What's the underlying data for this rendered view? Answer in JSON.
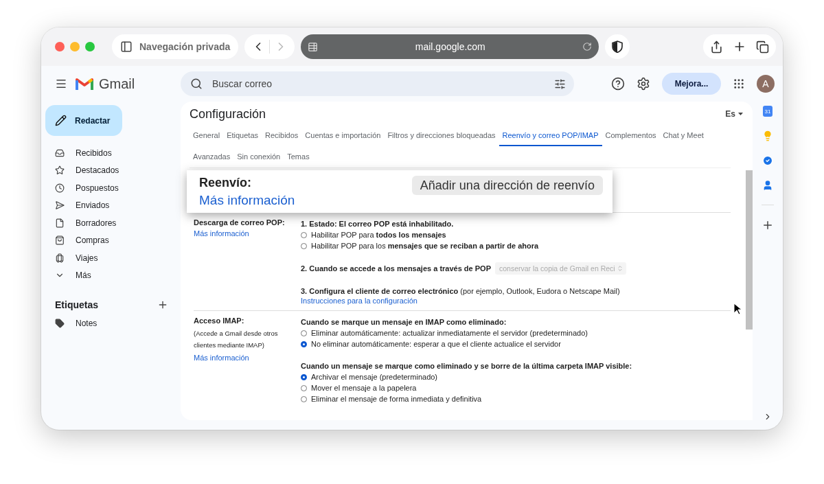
{
  "browser": {
    "private_label": "Navegación privada",
    "url": "mail.google.com"
  },
  "header": {
    "brand": "Gmail",
    "search_placeholder": "Buscar correo",
    "upgrade_button": "Mejora...",
    "avatar": "A"
  },
  "sidebar": {
    "compose": "Redactar",
    "items": [
      {
        "label": "Recibidos",
        "selected": false
      },
      {
        "label": "Destacados",
        "selected": false
      },
      {
        "label": "Pospuestos",
        "selected": false
      },
      {
        "label": "Enviados",
        "selected": false
      },
      {
        "label": "Borradores",
        "selected": false
      },
      {
        "label": "Compras",
        "selected": false
      },
      {
        "label": "Viajes",
        "selected": false
      },
      {
        "label": "Más",
        "selected": false
      }
    ],
    "labels_heading": "Etiquetas",
    "labels": [
      {
        "name": "Notes"
      }
    ]
  },
  "side_panel": {
    "calendar_day": "31"
  },
  "settings": {
    "title": "Configuración",
    "language": "Es",
    "tabs": [
      {
        "label": "General",
        "selected": false
      },
      {
        "label": "Etiquetas",
        "selected": false
      },
      {
        "label": "Recibidos",
        "selected": false
      },
      {
        "label": "Cuentas e importación",
        "selected": false
      },
      {
        "label": "Filtros y direcciones bloqueadas",
        "selected": false
      },
      {
        "label": "Reenvío y correo POP/IMAP",
        "selected": true
      },
      {
        "label": "Complementos",
        "selected": false
      },
      {
        "label": "Chat y Meet",
        "selected": false
      },
      {
        "label": "Avanzadas",
        "selected": false
      },
      {
        "label": "Sin conexión",
        "selected": false
      },
      {
        "label": "Temas",
        "selected": false
      }
    ],
    "forwarding": {
      "title": "Reenvío:",
      "link": "Más información",
      "button": "Añadir una dirección de reenvío"
    },
    "pop": {
      "label": "Descarga de correo POP:",
      "link": "Más información",
      "status": "1. Estado: El correo POP está inhabilitado.",
      "options": [
        {
          "text": "Habilitar POP para **todos los mensajes**",
          "selected": false
        },
        {
          "text": "Habilitar POP para los **mensajes que se reciban a partir de ahora**",
          "selected": false
        }
      ],
      "step2": "2. Cuando se accede a los mensajes a través de POP",
      "step2_select": "conservar la copia de Gmail en Reci",
      "step3": "**3. Configura el cliente de correo electrónico** (por ejemplo, Outlook, Eudora o Netscape Mail)",
      "step3_link": "Instrucciones para la configuración"
    },
    "imap": {
      "label": "Acceso IMAP:",
      "note": "(Accede a Gmail desde otros clientes mediante IMAP)",
      "link": "Más información",
      "groups": [
        {
          "heading": "Cuando se marque un mensaje en IMAP como eliminado:",
          "options": [
            {
              "text": "Eliminar automáticamente: actualizar inmediatamente el servidor (predeterminado)",
              "selected": false
            },
            {
              "text": "No eliminar automáticamente: esperar a que el cliente actualice el servidor",
              "selected": true
            }
          ]
        },
        {
          "heading": "Cuando un mensaje se marque como eliminado y se borre de la última carpeta IMAP visible:",
          "options": [
            {
              "text": "Archivar el mensaje (predeterminado)",
              "selected": true
            },
            {
              "text": "Mover el mensaje a la papelera",
              "selected": false
            },
            {
              "text": "Eliminar el mensaje de forma inmediata y definitiva",
              "selected": false
            }
          ]
        }
      ]
    }
  }
}
